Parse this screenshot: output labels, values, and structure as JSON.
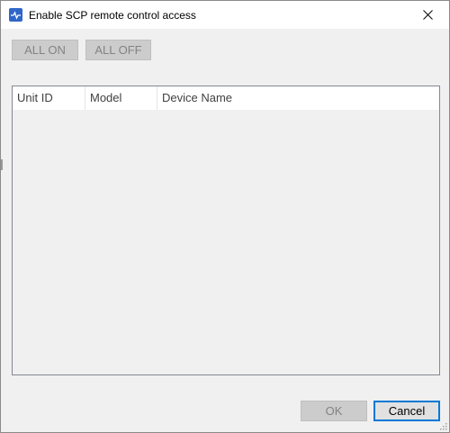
{
  "window": {
    "title": "Enable SCP remote control access",
    "app_icon": "waveform-app-icon",
    "close_icon": "close-icon"
  },
  "toolbar": {
    "all_on_label": "ALL ON",
    "all_off_label": "ALL OFF"
  },
  "table": {
    "columns": [
      "Unit ID",
      "Model",
      "Device Name"
    ],
    "rows": []
  },
  "footer": {
    "ok_label": "OK",
    "cancel_label": "Cancel"
  },
  "colors": {
    "accent": "#0078d7",
    "icon": "#2f66c9",
    "disabled_bg": "#cccccc",
    "disabled_text": "#838383"
  }
}
